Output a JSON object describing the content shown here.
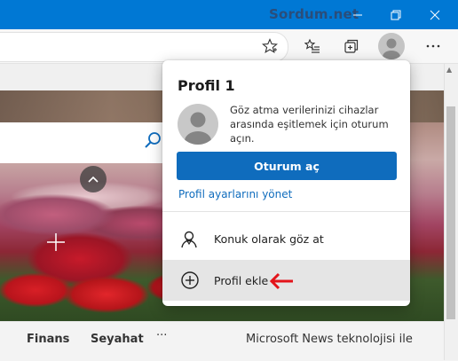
{
  "titlebar": {
    "watermark": "Sordum.net",
    "minimize_icon": "minimize-icon",
    "restore_icon": "restore-icon",
    "close_icon": "close-icon"
  },
  "toolbar": {
    "icons": [
      "star-favorite-icon",
      "favorites-list-icon",
      "collections-icon",
      "profile-avatar-icon",
      "more-ellipsis-icon"
    ]
  },
  "profile_popup": {
    "title": "Profil 1",
    "description": "Göz atma verilerinizi cihazlar arasında eşitlemek için oturum açın.",
    "signin_button": "Oturum aç",
    "manage_link": "Profil ayarlarını yönet",
    "menu": [
      {
        "label": "Konuk olarak göz at",
        "icon": "guest-user-icon"
      },
      {
        "label": "Profil ekle",
        "icon": "add-circle-icon"
      }
    ],
    "annotation_color": "#e3141a",
    "signin_color": "#0f6cbd"
  },
  "page": {
    "tabs": [
      "Finans",
      "Seyahat"
    ],
    "more_label": "···",
    "news_text": "Microsoft News teknolojisi ile"
  },
  "colors": {
    "titlebar": "#0078d4",
    "link": "#0f6cbd"
  }
}
